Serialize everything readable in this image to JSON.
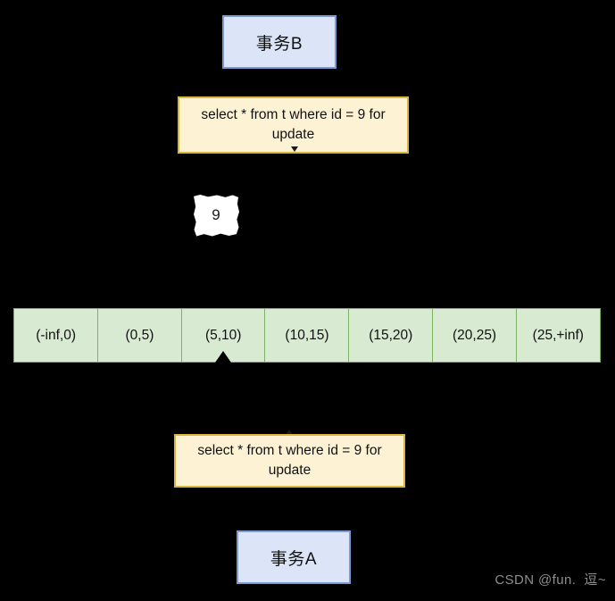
{
  "diagram": {
    "background_color": "#000000",
    "transactions": {
      "top": {
        "label": "事务B",
        "fill": "#dbe5f7",
        "border": "#7b9ad1"
      },
      "bottom": {
        "label": "事务A",
        "fill": "#dbe5f7",
        "border": "#7b9ad1"
      }
    },
    "statements": {
      "top": {
        "text": "select * from t where id = 9  for update",
        "fill": "#fdf3d4",
        "border": "#d6b63c"
      },
      "bottom": {
        "text": "select * from t where id = 9  for update",
        "fill": "#fdf3d4",
        "border": "#d6b63c"
      }
    },
    "note": {
      "text": "9",
      "fill": "#ffffff"
    },
    "intervals": {
      "fill": "#d9ead3",
      "border": "#7cb264",
      "cells": [
        "(-inf,0)",
        "(0,5)",
        "(5,10)",
        "(10,15)",
        "(15,20)",
        "(20,25)",
        "(25,+inf)"
      ]
    },
    "connectors": [
      {
        "name": "gap-lock-to-transaction-b",
        "direction": "up",
        "from": "(5,10)"
      },
      {
        "name": "into-statement-top",
        "direction": "down"
      },
      {
        "name": "into-statement-bottom",
        "direction": "up"
      }
    ]
  },
  "watermark": {
    "text": "CSDN @fun.  逗~",
    "color": "#8e8e8e"
  }
}
